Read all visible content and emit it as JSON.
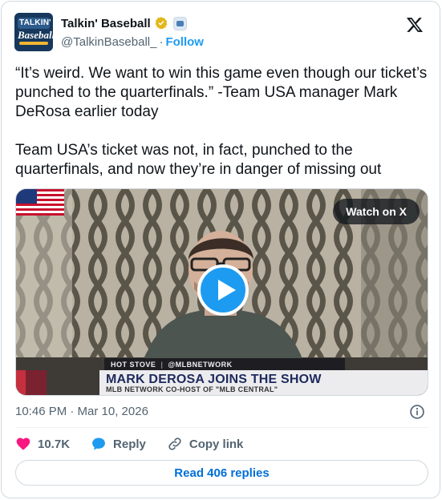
{
  "author": {
    "display_name": "Talkin' Baseball",
    "handle": "@TalkinBaseball_",
    "separator": "·",
    "follow_label": "Follow",
    "avatar_word1": "TALKIN'",
    "avatar_word2": "Baseball"
  },
  "tweet": {
    "paragraph1": "“It’s weird. We want to win this game even though our ticket’s punched to the quarterfinals.” -Team USA manager Mark DeRosa earlier today",
    "paragraph2": "Team USA’s ticket was not, in fact, punched to the quarterfinals, and now they’re in danger of missing out"
  },
  "media": {
    "watch_label": "Watch on X",
    "hotstove_label": "HOT STOVE",
    "hotstove_handle": "@MLBNETWORK",
    "headline": "MARK DEROSA JOINS THE SHOW",
    "subheadline": "MLB NETWORK CO-HOST OF \"MLB CENTRAL\""
  },
  "meta": {
    "timestamp": "10:46 PM · Mar 10, 2026"
  },
  "actions": {
    "likes": "10.7K",
    "reply_label": "Reply",
    "copy_label": "Copy link"
  },
  "read_replies_label": "Read 406 replies",
  "colors": {
    "accent": "#1d9bf0",
    "like": "#f91880",
    "muted": "#536471"
  }
}
